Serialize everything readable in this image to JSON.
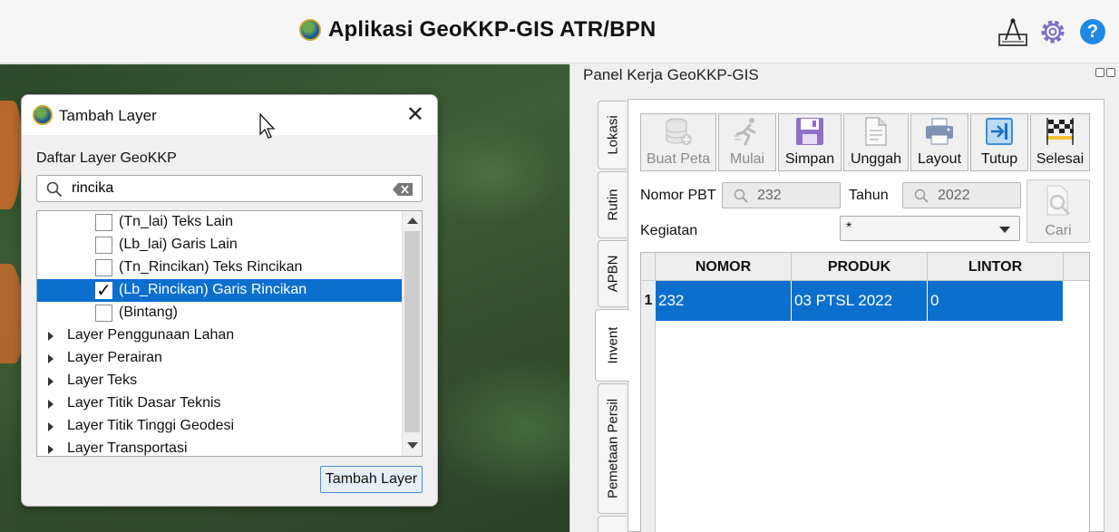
{
  "app": {
    "title": "Aplikasi GeoKKP-GIS ATR/BPN"
  },
  "dialog": {
    "title": "Tambah Layer",
    "list_label": "Daftar Layer GeoKKP",
    "search_value": "rincika",
    "items": [
      {
        "label": "(Tn_lai) Teks Lain",
        "checked": false
      },
      {
        "label": "(Lb_lai) Garis Lain",
        "checked": false
      },
      {
        "label": "(Tn_Rincikan) Teks Rincikan",
        "checked": false
      },
      {
        "label": "(Lb_Rincikan) Garis Rincikan",
        "checked": true,
        "selected": true,
        "check_mark": "✓"
      },
      {
        "label": "(Bintang)",
        "checked": false
      }
    ],
    "groups": [
      "Layer Penggunaan Lahan",
      "Layer Perairan",
      "Layer Teks",
      "Layer Titik Dasar Teknis",
      "Layer Titik Tinggi Geodesi",
      "Layer Transportasi"
    ],
    "add_button": "Tambah Layer"
  },
  "panel": {
    "title": "Panel Kerja GeoKKP-GIS",
    "tabs": [
      "Lokasi",
      "Rutin",
      "APBN",
      "Invent",
      "Pemetaan Persil"
    ],
    "active_tab": "Invent",
    "toolbar": [
      {
        "label": "Buat Peta",
        "enabled": false
      },
      {
        "label": "Mulai",
        "enabled": false
      },
      {
        "label": "Simpan",
        "enabled": true
      },
      {
        "label": "Unggah",
        "enabled": true
      },
      {
        "label": "Layout",
        "enabled": true
      },
      {
        "label": "Tutup",
        "enabled": true
      },
      {
        "label": "Selesai",
        "enabled": true
      }
    ],
    "nomor_pbt_label": "Nomor PBT",
    "nomor_pbt_value": "232",
    "tahun_label": "Tahun",
    "tahun_value": "2022",
    "kegiatan_label": "Kegiatan",
    "kegiatan_value": "*",
    "cari_label": "Cari",
    "grid": {
      "columns": [
        "NOMOR",
        "PRODUK",
        "LINTOR"
      ],
      "rows": [
        {
          "index": "1",
          "cells": [
            "232",
            "03 PTSL 2022",
            "0"
          ]
        }
      ]
    }
  },
  "colors": {
    "selection": "#0b6fce",
    "accent": "#1e88e5"
  }
}
